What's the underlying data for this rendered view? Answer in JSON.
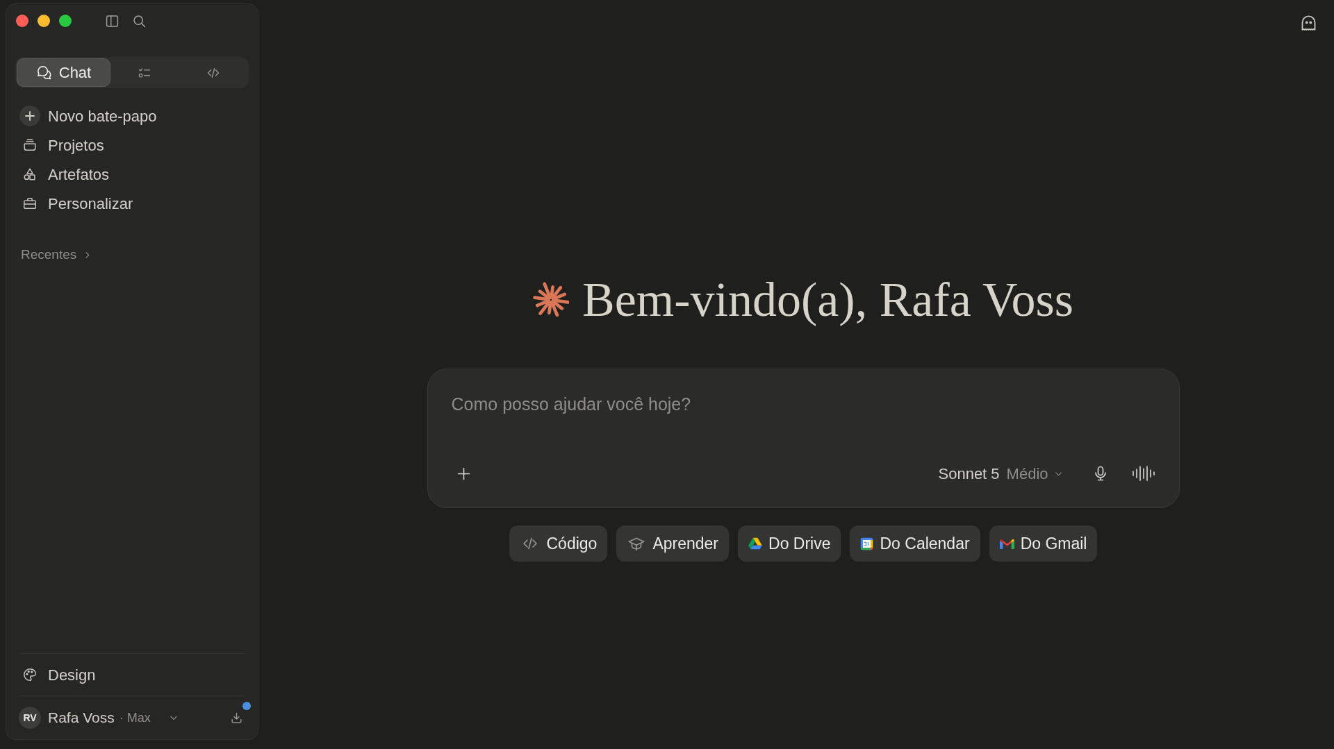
{
  "sidebar": {
    "mode_tabs": [
      {
        "kind": "chat",
        "label": "Chat",
        "selected": true
      },
      {
        "kind": "tasks",
        "selected": false
      },
      {
        "kind": "code",
        "selected": false
      }
    ],
    "nav_items": [
      {
        "kind": "new",
        "label": "Novo bate-papo"
      },
      {
        "kind": "projects",
        "label": "Projetos"
      },
      {
        "kind": "artifacts",
        "label": "Artefatos"
      },
      {
        "kind": "customize",
        "label": "Personalizar"
      }
    ],
    "recents": {
      "label": "Recentes",
      "expanded": false
    },
    "footer_item": {
      "label": "Design"
    },
    "user": {
      "initials": "RV",
      "name": "Rafa Voss",
      "plan": "· Max",
      "notification": true
    }
  },
  "main": {
    "greeting": "Bem-vindo(a), Rafa Voss",
    "composer": {
      "placeholder": "Como posso ajudar você hoje?",
      "model": "Sonnet 5",
      "effort": "Médio"
    },
    "suggestions": [
      {
        "kind": "code",
        "label": "Código"
      },
      {
        "kind": "learn",
        "label": "Aprender"
      },
      {
        "kind": "drive",
        "label": "Do Drive"
      },
      {
        "kind": "calendar",
        "label": "Do Calendar"
      },
      {
        "kind": "gmail",
        "label": "Do Gmail"
      }
    ]
  }
}
